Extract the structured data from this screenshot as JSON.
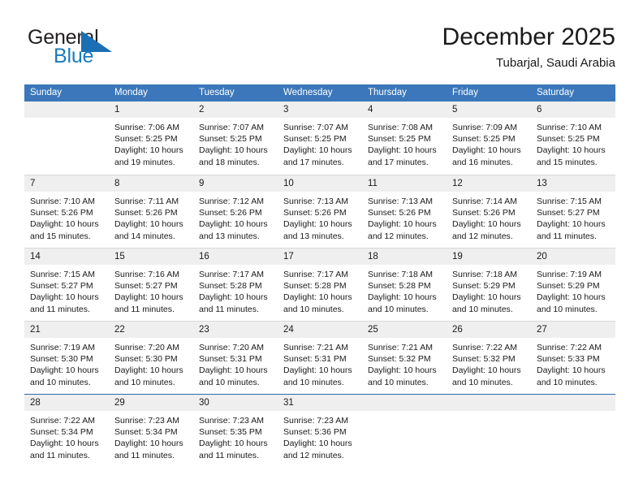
{
  "brand": {
    "word_one": "General",
    "word_two": "Blue",
    "triangle_color": "#1a6fb5",
    "blue_color": "#1a7bbd"
  },
  "header": {
    "title": "December 2025",
    "subtitle": "Tubarjal, Saudi Arabia"
  },
  "theme": {
    "header_blue": "#3b77ba",
    "day_band_gray": "#efefef",
    "grid_line": "#d8d8d8"
  },
  "weekdays": [
    "Sunday",
    "Monday",
    "Tuesday",
    "Wednesday",
    "Thursday",
    "Friday",
    "Saturday"
  ],
  "weeks": [
    [
      {
        "day": "",
        "sunrise": "",
        "sunset": "",
        "daylight_1": "",
        "daylight_2": "",
        "empty": true
      },
      {
        "day": "1",
        "sunrise": "Sunrise: 7:06 AM",
        "sunset": "Sunset: 5:25 PM",
        "daylight_1": "Daylight: 10 hours",
        "daylight_2": "and 19 minutes."
      },
      {
        "day": "2",
        "sunrise": "Sunrise: 7:07 AM",
        "sunset": "Sunset: 5:25 PM",
        "daylight_1": "Daylight: 10 hours",
        "daylight_2": "and 18 minutes."
      },
      {
        "day": "3",
        "sunrise": "Sunrise: 7:07 AM",
        "sunset": "Sunset: 5:25 PM",
        "daylight_1": "Daylight: 10 hours",
        "daylight_2": "and 17 minutes."
      },
      {
        "day": "4",
        "sunrise": "Sunrise: 7:08 AM",
        "sunset": "Sunset: 5:25 PM",
        "daylight_1": "Daylight: 10 hours",
        "daylight_2": "and 17 minutes."
      },
      {
        "day": "5",
        "sunrise": "Sunrise: 7:09 AM",
        "sunset": "Sunset: 5:25 PM",
        "daylight_1": "Daylight: 10 hours",
        "daylight_2": "and 16 minutes."
      },
      {
        "day": "6",
        "sunrise": "Sunrise: 7:10 AM",
        "sunset": "Sunset: 5:25 PM",
        "daylight_1": "Daylight: 10 hours",
        "daylight_2": "and 15 minutes."
      }
    ],
    [
      {
        "day": "7",
        "sunrise": "Sunrise: 7:10 AM",
        "sunset": "Sunset: 5:26 PM",
        "daylight_1": "Daylight: 10 hours",
        "daylight_2": "and 15 minutes."
      },
      {
        "day": "8",
        "sunrise": "Sunrise: 7:11 AM",
        "sunset": "Sunset: 5:26 PM",
        "daylight_1": "Daylight: 10 hours",
        "daylight_2": "and 14 minutes."
      },
      {
        "day": "9",
        "sunrise": "Sunrise: 7:12 AM",
        "sunset": "Sunset: 5:26 PM",
        "daylight_1": "Daylight: 10 hours",
        "daylight_2": "and 13 minutes."
      },
      {
        "day": "10",
        "sunrise": "Sunrise: 7:13 AM",
        "sunset": "Sunset: 5:26 PM",
        "daylight_1": "Daylight: 10 hours",
        "daylight_2": "and 13 minutes."
      },
      {
        "day": "11",
        "sunrise": "Sunrise: 7:13 AM",
        "sunset": "Sunset: 5:26 PM",
        "daylight_1": "Daylight: 10 hours",
        "daylight_2": "and 12 minutes."
      },
      {
        "day": "12",
        "sunrise": "Sunrise: 7:14 AM",
        "sunset": "Sunset: 5:26 PM",
        "daylight_1": "Daylight: 10 hours",
        "daylight_2": "and 12 minutes."
      },
      {
        "day": "13",
        "sunrise": "Sunrise: 7:15 AM",
        "sunset": "Sunset: 5:27 PM",
        "daylight_1": "Daylight: 10 hours",
        "daylight_2": "and 11 minutes."
      }
    ],
    [
      {
        "day": "14",
        "sunrise": "Sunrise: 7:15 AM",
        "sunset": "Sunset: 5:27 PM",
        "daylight_1": "Daylight: 10 hours",
        "daylight_2": "and 11 minutes."
      },
      {
        "day": "15",
        "sunrise": "Sunrise: 7:16 AM",
        "sunset": "Sunset: 5:27 PM",
        "daylight_1": "Daylight: 10 hours",
        "daylight_2": "and 11 minutes."
      },
      {
        "day": "16",
        "sunrise": "Sunrise: 7:17 AM",
        "sunset": "Sunset: 5:28 PM",
        "daylight_1": "Daylight: 10 hours",
        "daylight_2": "and 11 minutes."
      },
      {
        "day": "17",
        "sunrise": "Sunrise: 7:17 AM",
        "sunset": "Sunset: 5:28 PM",
        "daylight_1": "Daylight: 10 hours",
        "daylight_2": "and 10 minutes."
      },
      {
        "day": "18",
        "sunrise": "Sunrise: 7:18 AM",
        "sunset": "Sunset: 5:28 PM",
        "daylight_1": "Daylight: 10 hours",
        "daylight_2": "and 10 minutes."
      },
      {
        "day": "19",
        "sunrise": "Sunrise: 7:18 AM",
        "sunset": "Sunset: 5:29 PM",
        "daylight_1": "Daylight: 10 hours",
        "daylight_2": "and 10 minutes."
      },
      {
        "day": "20",
        "sunrise": "Sunrise: 7:19 AM",
        "sunset": "Sunset: 5:29 PM",
        "daylight_1": "Daylight: 10 hours",
        "daylight_2": "and 10 minutes."
      }
    ],
    [
      {
        "day": "21",
        "sunrise": "Sunrise: 7:19 AM",
        "sunset": "Sunset: 5:30 PM",
        "daylight_1": "Daylight: 10 hours",
        "daylight_2": "and 10 minutes."
      },
      {
        "day": "22",
        "sunrise": "Sunrise: 7:20 AM",
        "sunset": "Sunset: 5:30 PM",
        "daylight_1": "Daylight: 10 hours",
        "daylight_2": "and 10 minutes."
      },
      {
        "day": "23",
        "sunrise": "Sunrise: 7:20 AM",
        "sunset": "Sunset: 5:31 PM",
        "daylight_1": "Daylight: 10 hours",
        "daylight_2": "and 10 minutes."
      },
      {
        "day": "24",
        "sunrise": "Sunrise: 7:21 AM",
        "sunset": "Sunset: 5:31 PM",
        "daylight_1": "Daylight: 10 hours",
        "daylight_2": "and 10 minutes."
      },
      {
        "day": "25",
        "sunrise": "Sunrise: 7:21 AM",
        "sunset": "Sunset: 5:32 PM",
        "daylight_1": "Daylight: 10 hours",
        "daylight_2": "and 10 minutes."
      },
      {
        "day": "26",
        "sunrise": "Sunrise: 7:22 AM",
        "sunset": "Sunset: 5:32 PM",
        "daylight_1": "Daylight: 10 hours",
        "daylight_2": "and 10 minutes."
      },
      {
        "day": "27",
        "sunrise": "Sunrise: 7:22 AM",
        "sunset": "Sunset: 5:33 PM",
        "daylight_1": "Daylight: 10 hours",
        "daylight_2": "and 10 minutes."
      }
    ],
    [
      {
        "day": "28",
        "sunrise": "Sunrise: 7:22 AM",
        "sunset": "Sunset: 5:34 PM",
        "daylight_1": "Daylight: 10 hours",
        "daylight_2": "and 11 minutes."
      },
      {
        "day": "29",
        "sunrise": "Sunrise: 7:23 AM",
        "sunset": "Sunset: 5:34 PM",
        "daylight_1": "Daylight: 10 hours",
        "daylight_2": "and 11 minutes."
      },
      {
        "day": "30",
        "sunrise": "Sunrise: 7:23 AM",
        "sunset": "Sunset: 5:35 PM",
        "daylight_1": "Daylight: 10 hours",
        "daylight_2": "and 11 minutes."
      },
      {
        "day": "31",
        "sunrise": "Sunrise: 7:23 AM",
        "sunset": "Sunset: 5:36 PM",
        "daylight_1": "Daylight: 10 hours",
        "daylight_2": "and 12 minutes."
      },
      {
        "day": "",
        "sunrise": "",
        "sunset": "",
        "daylight_1": "",
        "daylight_2": "",
        "empty": true
      },
      {
        "day": "",
        "sunrise": "",
        "sunset": "",
        "daylight_1": "",
        "daylight_2": "",
        "empty": true
      },
      {
        "day": "",
        "sunrise": "",
        "sunset": "",
        "daylight_1": "",
        "daylight_2": "",
        "empty": true
      }
    ]
  ]
}
